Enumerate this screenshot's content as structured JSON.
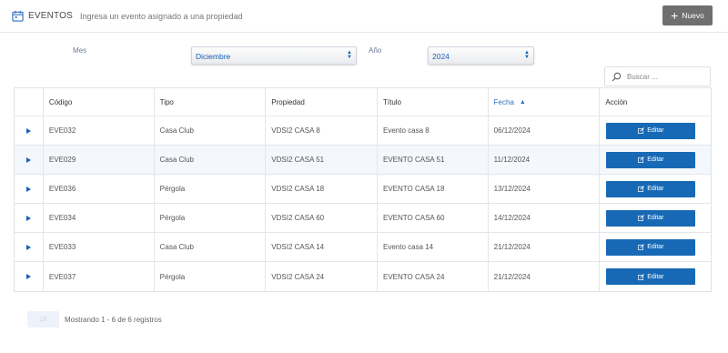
{
  "header": {
    "title": "EVENTOS",
    "subtitle": "Ingresa un evento asignado a una propiedad",
    "new_button": "Nuevo",
    "icon": "calendar-icon"
  },
  "filters": {
    "month_label": "Mes",
    "month_value": "Diciembre",
    "year_label": "Año",
    "year_value": "2024"
  },
  "search": {
    "placeholder": "Buscar ..."
  },
  "table": {
    "columns": [
      "",
      "Código",
      "Tipo",
      "Propiedad",
      "Título",
      "Fecha",
      "Acción"
    ],
    "sorted_column": "Fecha",
    "rows": [
      {
        "codigo": "EVE032",
        "tipo": "Casa Club",
        "propiedad": "VDSI2 CASA 8",
        "titulo": "Evento casa 8",
        "fecha": "06/12/2024",
        "accion": "Editar"
      },
      {
        "codigo": "EVE029",
        "tipo": "Casa Club",
        "propiedad": "VDSI2 CASA 51",
        "titulo": "EVENTO CASA 51",
        "fecha": "11/12/2024",
        "accion": "Editar"
      },
      {
        "codigo": "EVE036",
        "tipo": "Pérgola",
        "propiedad": "VDSI2 CASA 18",
        "titulo": "EVENTO CASA 18",
        "fecha": "13/12/2024",
        "accion": "Editar"
      },
      {
        "codigo": "EVE034",
        "tipo": "Pérgola",
        "propiedad": "VDSI2 CASA 60",
        "titulo": "EVENTO CASA 60",
        "fecha": "14/12/2024",
        "accion": "Editar"
      },
      {
        "codigo": "EVE033",
        "tipo": "Casa Club",
        "propiedad": "VDSI2 CASA 14",
        "titulo": "Evento casa 14",
        "fecha": "21/12/2024",
        "accion": "Editar"
      },
      {
        "codigo": "EVE037",
        "tipo": "Pérgola",
        "propiedad": "VDSI2 CASA 24",
        "titulo": "EVENTO CASA 24",
        "fecha": "21/12/2024",
        "accion": "Editar"
      }
    ]
  },
  "pagination": {
    "button": "10",
    "info": "Mostrando 1 - 6 de 6 registros"
  },
  "colors": {
    "accent": "#1769b5",
    "new_button_bg": "#6f6f6f",
    "alt_row": "#f4f7fb"
  }
}
